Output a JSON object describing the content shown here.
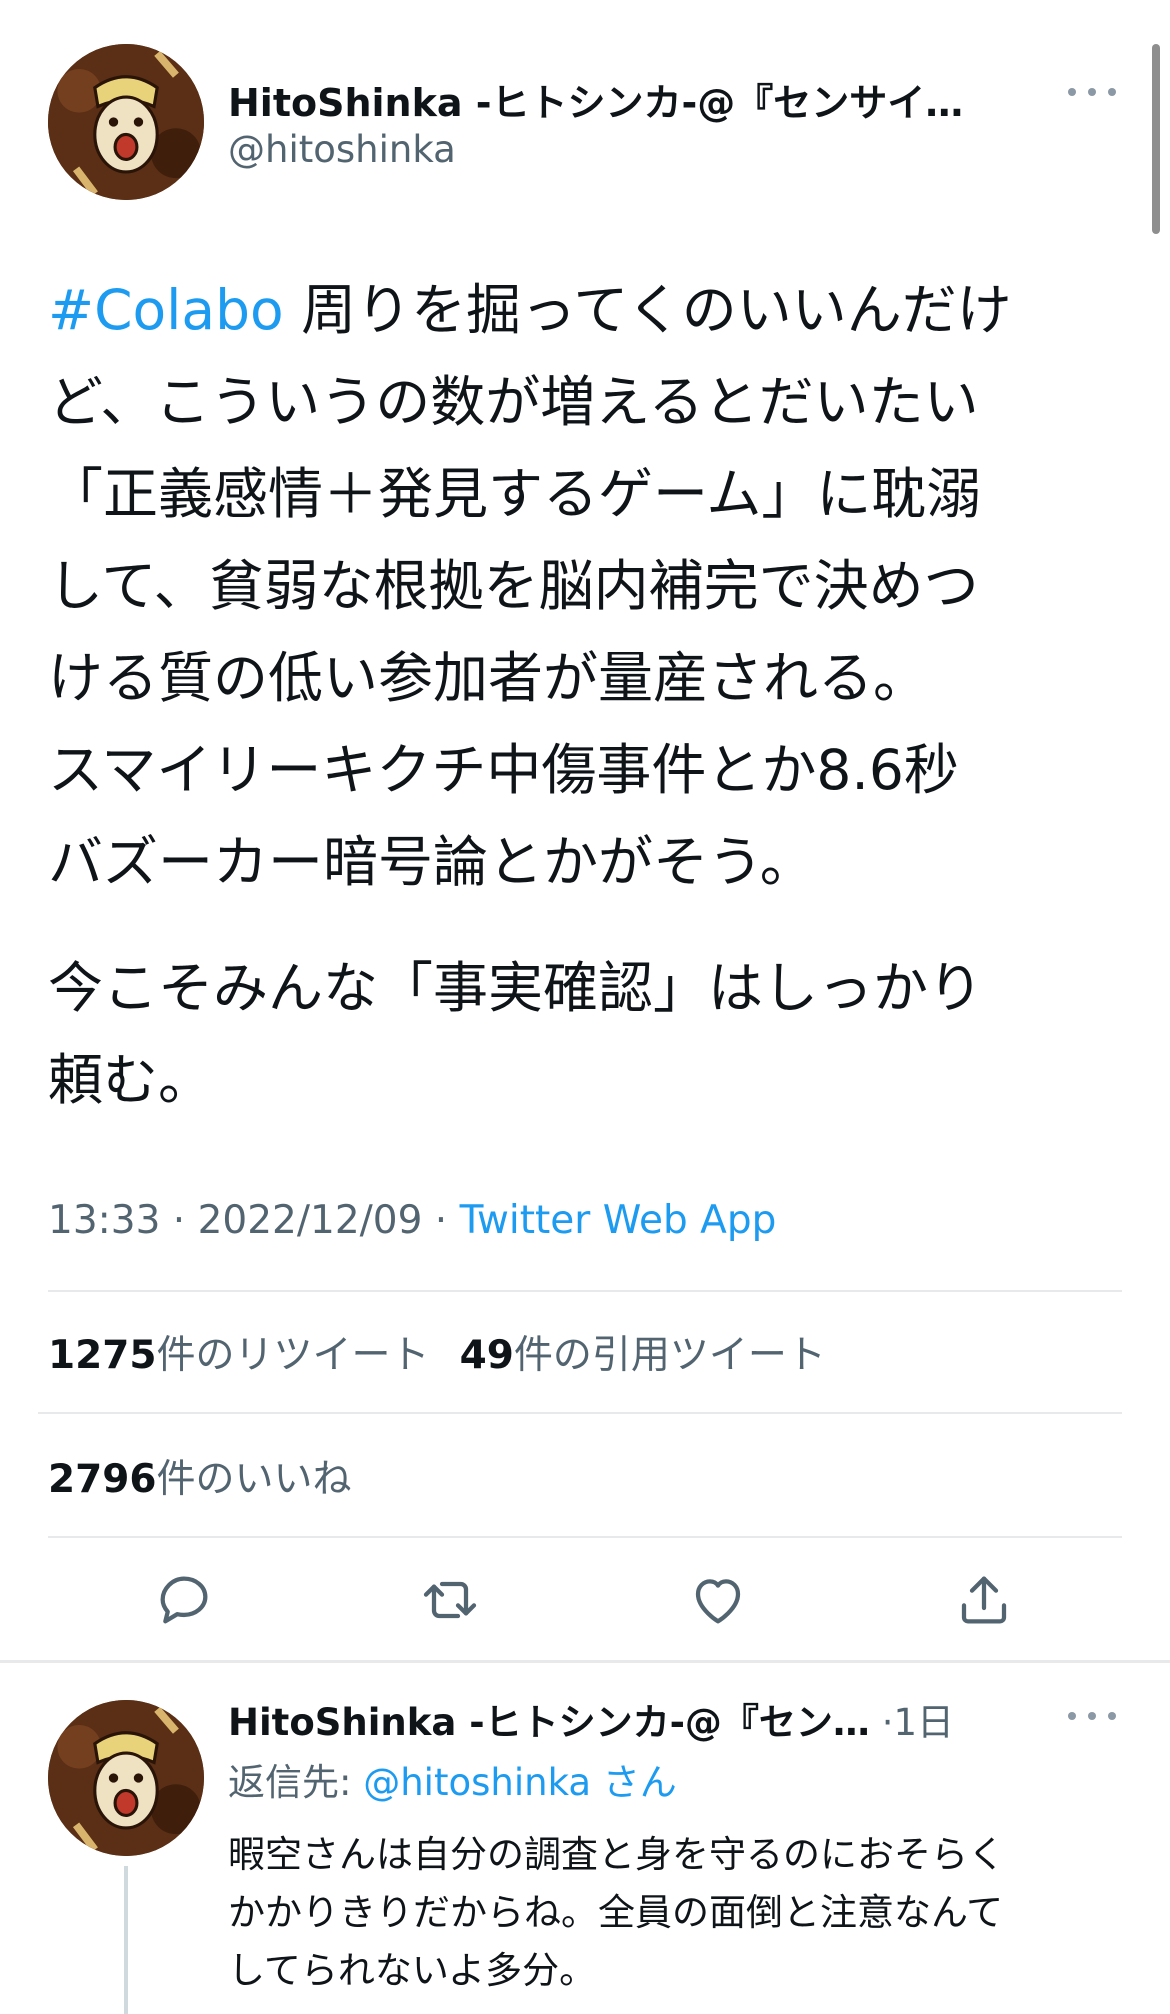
{
  "main_tweet": {
    "author_name": "HitoShinka -ヒトシンカ-@『センサイ…",
    "author_handle": "@hitoshinka",
    "hashtag": "#Colabo",
    "body_lines": [
      " 周りを掘ってくのいいんだけ",
      "ど、こういうの数が増えるとだいたい",
      "「正義感情＋発見するゲーム」に耽溺",
      "して、貧弱な根拠を脳内補完で決めつ",
      "ける質の低い参加者が量産される。",
      "スマイリーキクチ中傷事件とか8.6秒",
      "バズーカー暗号論とかがそう。"
    ],
    "body_para2_lines": [
      "今こそみんな「事実確認」はしっかり",
      "頼む。"
    ],
    "time": "13:33",
    "date": "2022/12/09",
    "separator": " · ",
    "source": "Twitter Web App"
  },
  "stats": {
    "retweets_count": "1275",
    "retweets_label": "件のリツイート",
    "quotes_count": "49",
    "quotes_label": "件の引用ツイート",
    "likes_count": "2796",
    "likes_label": "件のいいね"
  },
  "actions": {
    "icons": [
      "reply-icon",
      "retweet-icon",
      "like-icon",
      "share-icon"
    ]
  },
  "reply": {
    "author_name": "HitoShinka -ヒトシンカ-@『セン…",
    "time_sep": "·",
    "time": "1日",
    "reply_to_prefix": "返信先: ",
    "reply_to_mention": "@hitoshinka",
    "reply_to_suffix": " さん",
    "body_lines": [
      "暇空さんは自分の調査と身を守るのにおそらく",
      "かかりきりだからね。全員の面倒と注意なんて",
      "してられないよ多分。"
    ]
  },
  "colors": {
    "accent": "#1d9bf0",
    "text": "#0f1419",
    "secondary": "#536471",
    "divider": "#e7e9ea"
  }
}
